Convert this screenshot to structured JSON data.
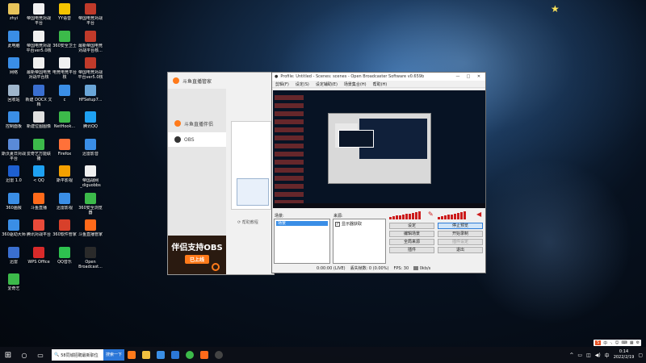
{
  "desktop": {
    "icons": [
      {
        "label": "zhyi",
        "color": "#e8c45a"
      },
      {
        "label": "帝国电竞对战平台",
        "color": "#f0f0f0"
      },
      {
        "label": "YY语音",
        "color": "#f5c400"
      },
      {
        "label": "帝国电竞对战平台",
        "color": "#c03a2a"
      },
      {
        "label": "此电脑",
        "color": "#3a8ee6"
      },
      {
        "label": "帝国电竞对战平台ver5.0核",
        "color": "#f0f0f0"
      },
      {
        "label": "360安全卫士",
        "color": "#3cba4a"
      },
      {
        "label": "最新帝国电竞对战平台核...",
        "color": "#c03a2a"
      },
      {
        "label": "网络",
        "color": "#3a8ee6"
      },
      {
        "label": "最新帝国电竞对战平台核",
        "color": "#f0f0f0"
      },
      {
        "label": "电竞电竞平台核",
        "color": "#f0f0f0"
      },
      {
        "label": "帝国电竞对战平台ver5.0核",
        "color": "#c03a2a"
      },
      {
        "label": "回收站",
        "color": "#9fb6cc"
      },
      {
        "label": "新建 DOCX 文档",
        "color": "#3a6fd0"
      },
      {
        "label": "c",
        "color": "#3a8ee6"
      },
      {
        "label": "HFSetup7...",
        "color": "#6aa6d8"
      },
      {
        "label": "控制面板",
        "color": "#3a8ee6"
      },
      {
        "label": "新建位图图像",
        "color": "#e0e0e0"
      },
      {
        "label": "NetHook...",
        "color": "#3cba4a"
      },
      {
        "label": "腾讯QQ",
        "color": "#1ea1f2"
      },
      {
        "label": "斯沃夏日对战平台",
        "color": "#5a8ad8"
      },
      {
        "label": "爱奇艺万能联播",
        "color": "#3cba4a"
      },
      {
        "label": "Firefox",
        "color": "#ff7139"
      },
      {
        "label": "迅雷影音",
        "color": "#3a8ee6"
      },
      {
        "label": "迅雷 1.0",
        "color": "#1e5fd0"
      },
      {
        "label": "< QQ",
        "color": "#1ea1f2"
      },
      {
        "label": "斯平影视",
        "color": "#f5a000"
      },
      {
        "label": "帝国战网_diguobbs",
        "color": "#f0f0f0"
      },
      {
        "label": "360画报",
        "color": "#3a8ee6"
      },
      {
        "label": "斗鱼直播",
        "color": "#ff6a1a"
      },
      {
        "label": "迅雷影视",
        "color": "#3a8ee6"
      },
      {
        "label": "360安全浏览器",
        "color": "#3cba4a"
      },
      {
        "label": "360驱动大师",
        "color": "#3a8ee6"
      },
      {
        "label": "腾讯对战平台",
        "color": "#e84a3a"
      },
      {
        "label": "360软件管家",
        "color": "#d8402a"
      },
      {
        "label": "斗鱼直播管家",
        "color": "#ff6a1a"
      },
      {
        "label": "迅雷",
        "color": "#3a6fd0"
      },
      {
        "label": "WPS Office",
        "color": "#d82a2a"
      },
      {
        "label": "QQ音乐",
        "color": "#2ec24f"
      },
      {
        "label": "Open Broadcast...",
        "color": "#2a2a2a"
      },
      {
        "label": "爱奇艺",
        "color": "#3cba4a"
      }
    ]
  },
  "douyu": {
    "title": "斗鱼直播管家",
    "sidebar_items": [
      {
        "label": "斗鱼直播伴侣"
      },
      {
        "label": "OBS"
      }
    ],
    "help_text": "帮助教程",
    "promo": {
      "title": "伴侣支持OBS",
      "subtitle": "已上线"
    }
  },
  "obs": {
    "title": "Profile: Untitled - Scenes: scenes - Open Broadcaster Software v0.659b",
    "menu": [
      "剪辑(F)",
      "设定(S)",
      "设定辅助(E)",
      "场景集合(H)",
      "帮助(H)"
    ],
    "scenes_label": "场景:",
    "sources_label": "来源:",
    "scene_item": "场景",
    "source_item": "显示器获取",
    "source_checked": "✓",
    "buttons": {
      "settings": "设定",
      "stop_preview": "停止预览",
      "edit_scene": "编辑场景",
      "start_recording": "开始录制",
      "fullscreen_preview": "全局来源",
      "disabled": "插件设定",
      "plugins": "插件",
      "exit": "退出"
    },
    "status": {
      "time": "0:00:00 (LIVE)",
      "dropped": "丢失帧数: 0 (0.00%)",
      "fps": "FPS: 30",
      "kbps": "0kb/s"
    }
  },
  "taskbar": {
    "news_text": "58同城招聘最新职位",
    "news_button": "搜索一下",
    "time": "0:14",
    "date": "2022/2/19",
    "ime": [
      "S",
      "中",
      "·,",
      "☺",
      "⌨",
      "▦",
      "⚙"
    ]
  }
}
